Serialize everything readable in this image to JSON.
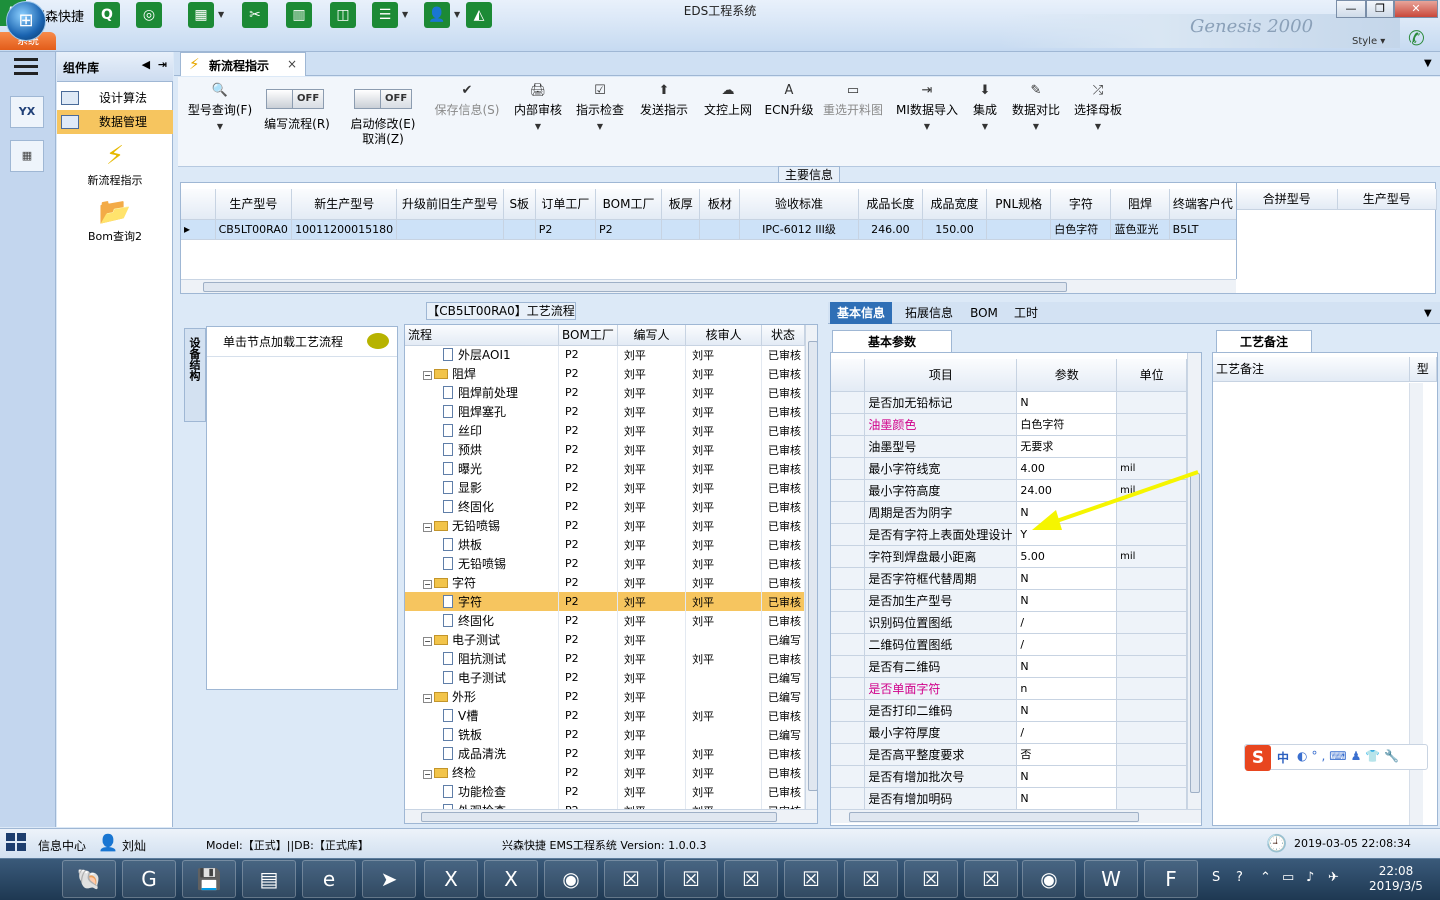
{
  "app": {
    "name": "兴森快捷",
    "window_title": "EDS工程系统",
    "banner": "Genesis 2000",
    "style_label": "Style",
    "system_tab": "系统",
    "win_controls": [
      "—",
      "❐",
      "✕"
    ]
  },
  "toolbar_icons": [
    "Q",
    "◎",
    "▦",
    "✂",
    "▥",
    "◫",
    "☰",
    "👤",
    "◭"
  ],
  "left_icons": [
    "YX",
    "▦"
  ],
  "component_library": {
    "title": "组件库",
    "items": [
      {
        "label": "设计算法",
        "selected": false
      },
      {
        "label": "数据管理",
        "selected": true
      }
    ],
    "big_items": [
      {
        "label": "新流程指示",
        "icon": "bolt-icon"
      },
      {
        "label": "Bom查询2",
        "icon": "folder-icon"
      }
    ]
  },
  "tab": {
    "label": "新流程指示"
  },
  "ribbon": {
    "buttons": [
      {
        "label": "型号查询(F)",
        "icon": "🔍",
        "disabled": false,
        "dropdown": true
      },
      {
        "label": "保存信息(S)",
        "icon": "✔",
        "disabled": true,
        "dropdown": false
      },
      {
        "label": "内部审核",
        "icon": "🖨",
        "disabled": false,
        "dropdown": true
      },
      {
        "label": "指示检查",
        "icon": "☑",
        "disabled": false,
        "dropdown": true
      },
      {
        "label": "发送指示",
        "icon": "⬆",
        "disabled": false,
        "dropdown": false
      },
      {
        "label": "文控上网",
        "icon": "☁",
        "disabled": false,
        "dropdown": false
      },
      {
        "label": "ECN升级",
        "icon": "A",
        "disabled": false,
        "dropdown": false
      },
      {
        "label": "重选开料图",
        "icon": "▭",
        "disabled": true,
        "dropdown": false
      },
      {
        "label": "MI数据导入",
        "icon": "⇥",
        "disabled": false,
        "dropdown": true
      },
      {
        "label": "集成",
        "icon": "⬇",
        "disabled": false,
        "dropdown": true
      },
      {
        "label": "数据对比",
        "icon": "✎",
        "disabled": false,
        "dropdown": true
      },
      {
        "label": "选择母板",
        "icon": "⤮",
        "disabled": false,
        "dropdown": true
      }
    ],
    "toggles": [
      {
        "state": "OFF",
        "label": "编写流程(R)"
      },
      {
        "state": "OFF",
        "label": "启动修改(E)",
        "label2": "取消(Z)"
      }
    ]
  },
  "main_info": {
    "legend": "主要信息",
    "columns": [
      "生产型号",
      "新生产型号",
      "升级前旧生产型号",
      "S板",
      "订单工厂",
      "BOM工厂",
      "板厚",
      "板材",
      "验收标准",
      "成品长度",
      "成品宽度",
      "PNL规格",
      "字符",
      "阻焊",
      "终端客户代"
    ],
    "row": [
      "CB5LT00RA0",
      "10011200015180",
      "",
      "",
      "P2",
      "P2",
      "",
      "",
      "IPC-6012 III级",
      "246.00",
      "150.00",
      "",
      "白色字符",
      "蓝色亚光",
      "B5LT"
    ],
    "side_columns": [
      "合拼型号",
      "生产型号"
    ]
  },
  "flow": {
    "legend": "【CB5LT00RA0】工艺流程",
    "side_tab": "设备结构",
    "node_hint": "单击节点加载工艺流程",
    "columns": [
      "流程",
      "BOM工厂",
      "编写人",
      "核审人",
      "状态"
    ],
    "rows": [
      {
        "name": "外层AOI1",
        "level": 2,
        "folder": false,
        "bom": "P2",
        "writer": "刘平",
        "checker": "刘平",
        "status": "已审核"
      },
      {
        "name": "阻焊",
        "level": 1,
        "folder": true,
        "bom": "P2",
        "writer": "刘平",
        "checker": "刘平",
        "status": "已审核"
      },
      {
        "name": "阻焊前处理",
        "level": 2,
        "folder": false,
        "bom": "P2",
        "writer": "刘平",
        "checker": "刘平",
        "status": "已审核"
      },
      {
        "name": "阻焊塞孔",
        "level": 2,
        "folder": false,
        "bom": "P2",
        "writer": "刘平",
        "checker": "刘平",
        "status": "已审核"
      },
      {
        "name": "丝印",
        "level": 2,
        "folder": false,
        "bom": "P2",
        "writer": "刘平",
        "checker": "刘平",
        "status": "已审核"
      },
      {
        "name": "预烘",
        "level": 2,
        "folder": false,
        "bom": "P2",
        "writer": "刘平",
        "checker": "刘平",
        "status": "已审核"
      },
      {
        "name": "曝光",
        "level": 2,
        "folder": false,
        "bom": "P2",
        "writer": "刘平",
        "checker": "刘平",
        "status": "已审核"
      },
      {
        "name": "显影",
        "level": 2,
        "folder": false,
        "bom": "P2",
        "writer": "刘平",
        "checker": "刘平",
        "status": "已审核"
      },
      {
        "name": "终固化",
        "level": 2,
        "folder": false,
        "bom": "P2",
        "writer": "刘平",
        "checker": "刘平",
        "status": "已审核"
      },
      {
        "name": "无铅喷锡",
        "level": 1,
        "folder": true,
        "bom": "P2",
        "writer": "刘平",
        "checker": "刘平",
        "status": "已审核"
      },
      {
        "name": "烘板",
        "level": 2,
        "folder": false,
        "bom": "P2",
        "writer": "刘平",
        "checker": "刘平",
        "status": "已审核"
      },
      {
        "name": "无铅喷锡",
        "level": 2,
        "folder": false,
        "bom": "P2",
        "writer": "刘平",
        "checker": "刘平",
        "status": "已审核"
      },
      {
        "name": "字符",
        "level": 1,
        "folder": true,
        "bom": "P2",
        "writer": "刘平",
        "checker": "刘平",
        "status": "已审核"
      },
      {
        "name": "字符",
        "level": 2,
        "folder": false,
        "bom": "P2",
        "writer": "刘平",
        "checker": "刘平",
        "status": "已审核",
        "selected": true
      },
      {
        "name": "终固化",
        "level": 2,
        "folder": false,
        "bom": "P2",
        "writer": "刘平",
        "checker": "刘平",
        "status": "已审核"
      },
      {
        "name": "电子测试",
        "level": 1,
        "folder": true,
        "bom": "P2",
        "writer": "刘平",
        "checker": "",
        "status": "已编写"
      },
      {
        "name": "阻抗测试",
        "level": 2,
        "folder": false,
        "bom": "P2",
        "writer": "刘平",
        "checker": "刘平",
        "status": "已审核"
      },
      {
        "name": "电子测试",
        "level": 2,
        "folder": false,
        "bom": "P2",
        "writer": "刘平",
        "checker": "",
        "status": "已编写"
      },
      {
        "name": "外形",
        "level": 1,
        "folder": true,
        "bom": "P2",
        "writer": "刘平",
        "checker": "",
        "status": "已编写"
      },
      {
        "name": "V槽",
        "level": 2,
        "folder": false,
        "bom": "P2",
        "writer": "刘平",
        "checker": "刘平",
        "status": "已审核"
      },
      {
        "name": "铣板",
        "level": 2,
        "folder": false,
        "bom": "P2",
        "writer": "刘平",
        "checker": "",
        "status": "已编写"
      },
      {
        "name": "成品清洗",
        "level": 2,
        "folder": false,
        "bom": "P2",
        "writer": "刘平",
        "checker": "刘平",
        "status": "已审核"
      },
      {
        "name": "终检",
        "level": 1,
        "folder": true,
        "bom": "P2",
        "writer": "刘平",
        "checker": "刘平",
        "status": "已审核"
      },
      {
        "name": "功能检查",
        "level": 2,
        "folder": false,
        "bom": "P2",
        "writer": "刘平",
        "checker": "刘平",
        "status": "已审核"
      },
      {
        "name": "外观检查",
        "level": 2,
        "folder": false,
        "bom": "P2",
        "writer": "刘平",
        "checker": "刘平",
        "status": "已审核"
      }
    ]
  },
  "info_tabs": [
    "基本信息",
    "拓展信息",
    "BOM",
    "工时"
  ],
  "basic_params": {
    "subtab": "基本参数",
    "columns": [
      "项目",
      "参数",
      "单位"
    ],
    "rows": [
      {
        "item": "是否加无铅标记",
        "value": "N",
        "unit": ""
      },
      {
        "item": "油墨颜色",
        "value": "白色字符",
        "unit": "",
        "highlight": true
      },
      {
        "item": "油墨型号",
        "value": "无要求",
        "unit": ""
      },
      {
        "item": "最小字符线宽",
        "value": "4.00",
        "unit": "mil"
      },
      {
        "item": "最小字符高度",
        "value": "24.00",
        "unit": "mil"
      },
      {
        "item": "周期是否为阴字",
        "value": "N",
        "unit": ""
      },
      {
        "item": "是否有字符上表面处理设计",
        "value": "Y",
        "unit": ""
      },
      {
        "item": "字符到焊盘最小距离",
        "value": "5.00",
        "unit": "mil"
      },
      {
        "item": "是否字符框代替周期",
        "value": "N",
        "unit": ""
      },
      {
        "item": "是否加生产型号",
        "value": "N",
        "unit": ""
      },
      {
        "item": "识别码位置图纸",
        "value": "/",
        "unit": ""
      },
      {
        "item": "二维码位置图纸",
        "value": "/",
        "unit": ""
      },
      {
        "item": "是否有二维码",
        "value": "N",
        "unit": ""
      },
      {
        "item": "是否单面字符",
        "value": "n",
        "unit": "",
        "highlight": true
      },
      {
        "item": "是否打印二维码",
        "value": "N",
        "unit": ""
      },
      {
        "item": "最小字符厚度",
        "value": "/",
        "unit": ""
      },
      {
        "item": "是否高平整度要求",
        "value": "否",
        "unit": ""
      },
      {
        "item": "是否有增加批次号",
        "value": "N",
        "unit": ""
      },
      {
        "item": "是否有增加明码",
        "value": "N",
        "unit": ""
      }
    ]
  },
  "process_notes": {
    "tab": "工艺备注",
    "header": "工艺备注",
    "side": "型"
  },
  "ime": {
    "logo": "S",
    "mode": "中",
    "tools": "◐°,⌨♟👕🔧"
  },
  "status": {
    "center_label": "信息中心",
    "user": "刘灿",
    "model": "Model:【正式】||DB:【正式库】",
    "product": "兴森快捷 EMS工程系统 Version: 1.0.0.3",
    "datetime": "2019-03-05 22:08:34"
  },
  "taskbar": {
    "apps": [
      "🐚",
      "G",
      "💾",
      "▤",
      "e",
      "➤",
      "X",
      "X",
      "◉",
      "☒",
      "☒",
      "☒",
      "☒",
      "☒",
      "☒",
      "☒",
      "◉",
      "W",
      "F"
    ],
    "tray_icons": [
      "S",
      "?",
      "⌃",
      "▭",
      "♪",
      "✈"
    ],
    "time": "22:08",
    "date": "2019/3/5"
  },
  "colors": {
    "accent": "#2f6fb6",
    "selected_row": "#f6c55f",
    "highlight_text": "#d0008a",
    "arrow": "#f5f500"
  }
}
